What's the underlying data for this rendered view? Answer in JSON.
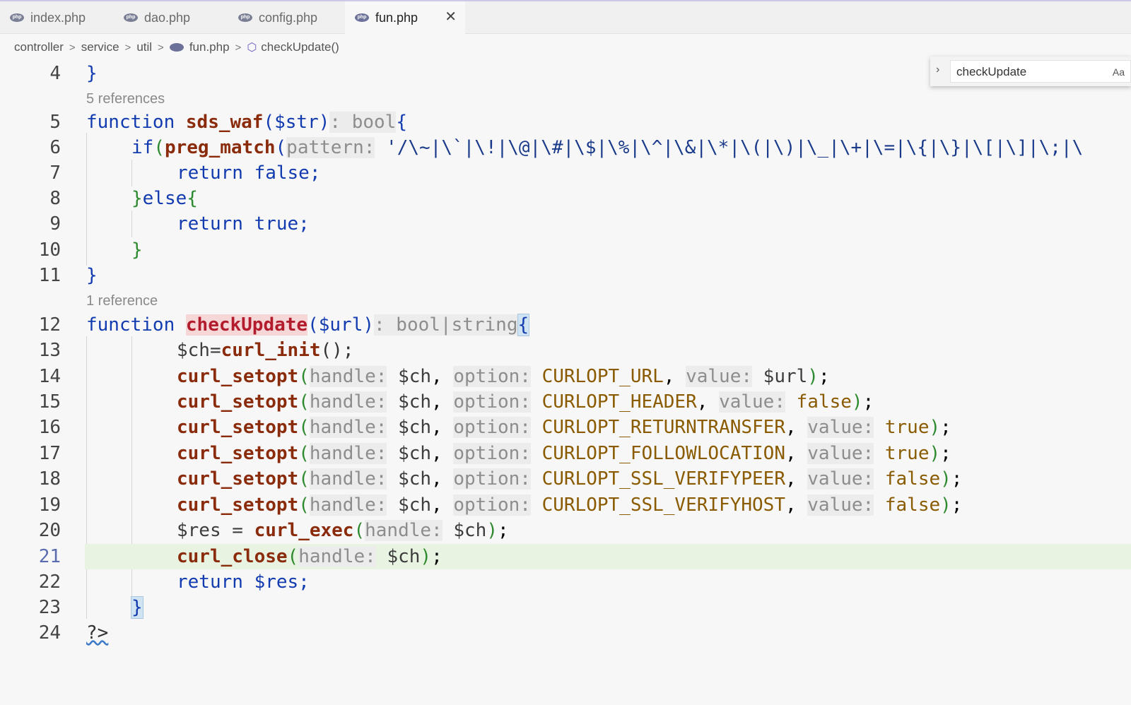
{
  "tabs": [
    {
      "label": "index.php",
      "icon": "php-file-icon"
    },
    {
      "label": "dao.php",
      "icon": "php-file-icon"
    },
    {
      "label": "config.php",
      "icon": "php-file-icon"
    },
    {
      "label": "fun.php",
      "icon": "php-file-icon",
      "active": true
    }
  ],
  "close_glyph": "✕",
  "breadcrumb": {
    "items": [
      "controller",
      "service",
      "util",
      "fun.php",
      "checkUpdate()"
    ],
    "separator": ">"
  },
  "find": {
    "value": "checkUpdate",
    "match_case_label": "Aa"
  },
  "references": {
    "sds_waf": "5 references",
    "checkUpdate": "1 reference"
  },
  "line_numbers": [
    "4",
    "5",
    "6",
    "7",
    "8",
    "9",
    "10",
    "11",
    "12",
    "13",
    "14",
    "15",
    "16",
    "17",
    "18",
    "19",
    "20",
    "21",
    "22",
    "23",
    "24"
  ],
  "current_line": "21",
  "code": {
    "l4": "}",
    "l5_kw": "function",
    "l5_fn": "sds_waf",
    "l5_params": "($str)",
    "l5_hint": ": bool",
    "l5_brace": "{",
    "l6_if": "if",
    "l6_fn": "preg_match",
    "l6_hint": "pattern:",
    "l6_str": " '/\\~|\\`|\\!|\\@|\\#|\\$|\\%|\\^|\\&|\\*|\\(|\\)|\\_|\\+|\\=|\\{|\\}|\\[|\\]|\\;|\\",
    "l7": "return false;",
    "l8_close": "}",
    "l8_else": "else",
    "l8_open": "{",
    "l9": "return true;",
    "l10": "}",
    "l11": "}",
    "l12_kw": "function",
    "l12_fn": "checkUpdate",
    "l12_params": "($url)",
    "l12_hint": ": bool|string",
    "l12_brace": "{",
    "l13_var": "$ch=",
    "l13_fn": "curl_init",
    "l13_rest": "();",
    "setopt_fn": "curl_setopt",
    "hint_handle": "handle:",
    "hint_option": "option:",
    "hint_value": "value:",
    "ch": "$ch",
    "l14_const": "CURLOPT_URL",
    "l14_val": "$url",
    "l15_const": "CURLOPT_HEADER",
    "l15_val": "false",
    "l16_const": "CURLOPT_RETURNTRANSFER",
    "l16_val": "true",
    "l17_const": "CURLOPT_FOLLOWLOCATION",
    "l17_val": "true",
    "l18_const": "CURLOPT_SSL_VERIFYPEER",
    "l18_val": "false",
    "l19_const": "CURLOPT_SSL_VERIFYHOST",
    "l19_val": "false",
    "l20_var": "$res = ",
    "l20_fn": "curl_exec",
    "l21_fn": "curl_close",
    "l22": "return $res;",
    "l23": "}",
    "l24": "?>"
  },
  "colors": {
    "keyword": "#123bb0",
    "function": "#8a2b0c",
    "constant": "#8a5b00",
    "hint": "#8d8d8d",
    "current_line_bg": "#e9f3e2"
  }
}
